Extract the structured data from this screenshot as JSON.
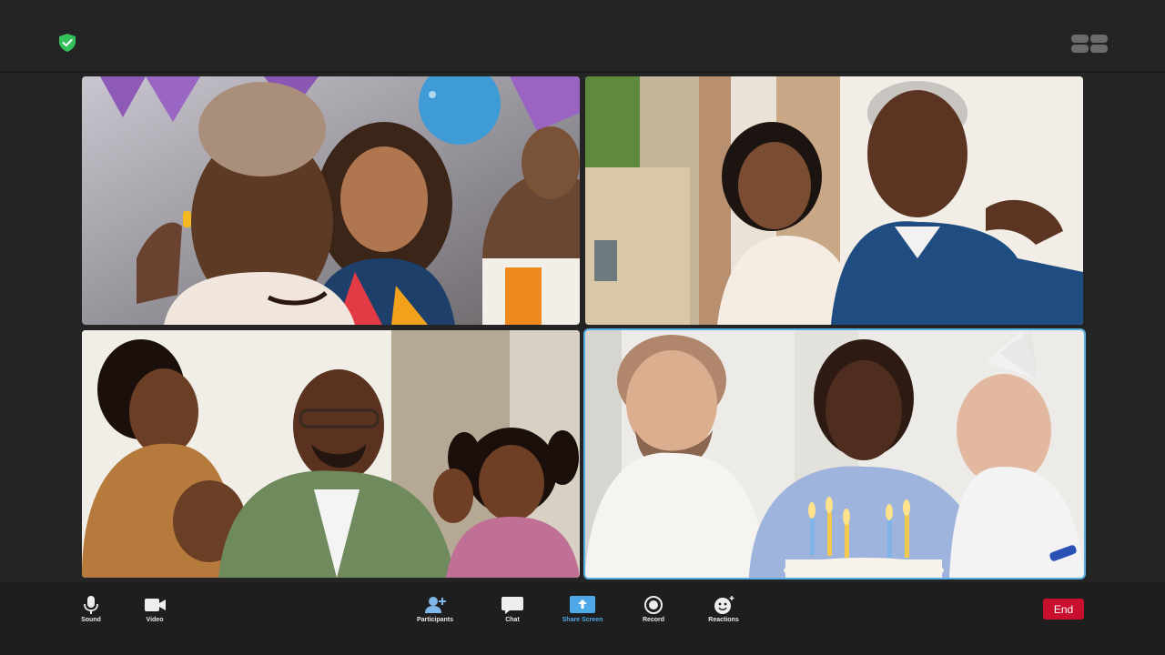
{
  "colors": {
    "background": "#242424",
    "toolbar": "#1e1e1e",
    "active_speaker_border": "#53aee4",
    "shield": "#35c05a",
    "end_button": "#c8102e",
    "share_screen_accent": "#4ea9e6"
  },
  "header": {
    "security_icon": "shield-check-icon",
    "view_icon": "gallery-view-icon"
  },
  "participants": [
    {
      "tile": "video-tile-1",
      "description_icon": "video-feed"
    },
    {
      "tile": "video-tile-2",
      "description_icon": "video-feed"
    },
    {
      "tile": "video-tile-3",
      "description_icon": "video-feed"
    },
    {
      "tile": "video-tile-4",
      "description_icon": "video-feed",
      "active_speaker": true
    }
  ],
  "toolbar": {
    "sound_label": "Sound",
    "video_label": "Video",
    "participants_label": "Participants",
    "chat_label": "Chat",
    "share_label": "Share Screen",
    "record_label": "Record",
    "reactions_label": "Reactions",
    "end_label": "End"
  }
}
